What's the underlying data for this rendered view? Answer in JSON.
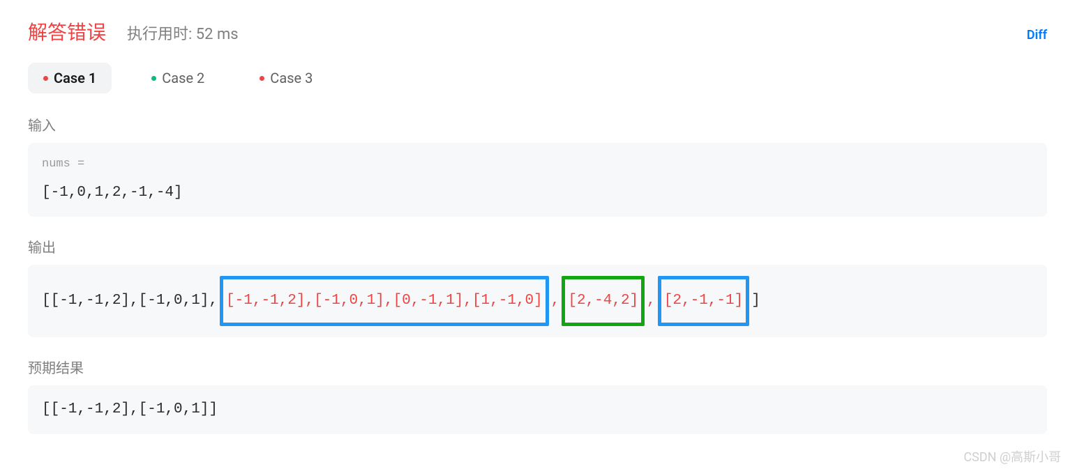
{
  "header": {
    "status_title": "解答错误",
    "runtime_text": "执行用时: 52 ms",
    "diff_label": "Diff"
  },
  "tabs": [
    {
      "label": "Case 1",
      "status": "red",
      "active": true
    },
    {
      "label": "Case 2",
      "status": "green",
      "active": false
    },
    {
      "label": "Case 3",
      "status": "red",
      "active": false
    }
  ],
  "sections": {
    "input": {
      "label": "输入",
      "var_label": "nums =",
      "value": "[-1,0,1,2,-1,-4]"
    },
    "output": {
      "label": "输出",
      "prefix": "[[-1,-1,2],[-1,0,1],",
      "highlighted_group_1": "[-1,-1,2],[-1,0,1],[0,-1,1],[1,-1,0]",
      "comma1": ",",
      "highlighted_group_2": "[2,-4,2]",
      "comma2": ",",
      "highlighted_group_3": "[2,-1,-1]",
      "suffix": "]"
    },
    "expected": {
      "label": "预期结果",
      "value": "[[-1,-1,2],[-1,0,1]]"
    }
  },
  "watermark": "CSDN @高斯小哥",
  "chart_data": {
    "type": "table",
    "title": "Wrong Answer - LeetCode Test Case",
    "input_nums": [
      -1,
      0,
      1,
      2,
      -1,
      -4
    ],
    "actual_output": [
      [
        -1,
        -1,
        2
      ],
      [
        -1,
        0,
        1
      ],
      [
        -1,
        -1,
        2
      ],
      [
        -1,
        0,
        1
      ],
      [
        0,
        -1,
        1
      ],
      [
        1,
        -1,
        0
      ],
      [
        2,
        -4,
        2
      ],
      [
        2,
        -1,
        -1
      ]
    ],
    "expected_output": [
      [
        -1,
        -1,
        2
      ],
      [
        -1,
        0,
        1
      ]
    ],
    "runtime_ms": 52,
    "cases": [
      {
        "name": "Case 1",
        "passed": false
      },
      {
        "name": "Case 2",
        "passed": true
      },
      {
        "name": "Case 3",
        "passed": false
      }
    ]
  }
}
